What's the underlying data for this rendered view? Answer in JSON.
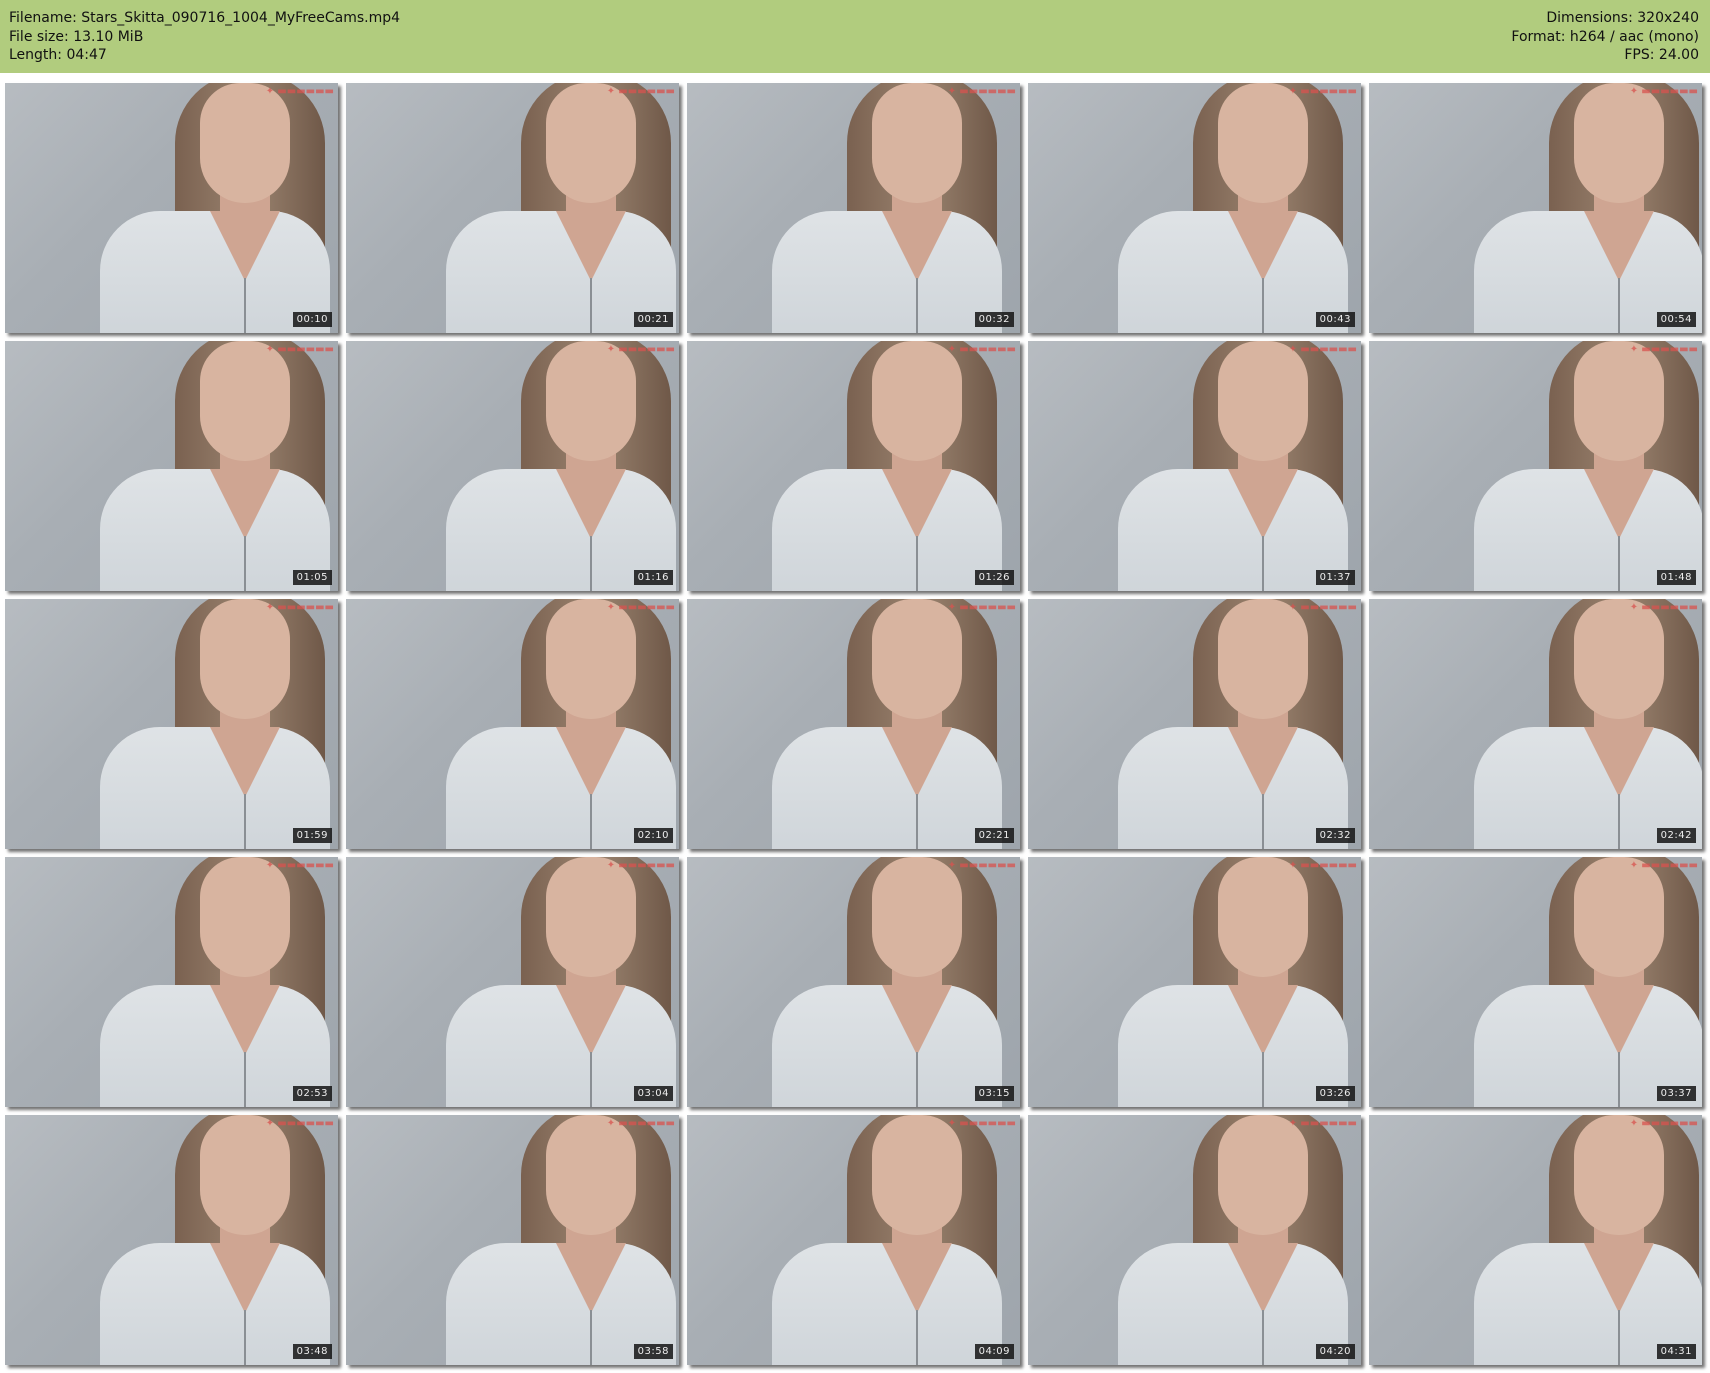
{
  "header": {
    "filename": "Filename: Stars_Skitta_090716_1004_MyFreeCams.mp4",
    "file_size": "File size: 13.10 MiB",
    "length": "Length: 04:47",
    "dimensions": "Dimensions: 320x240",
    "format": "Format: h264 / aac (mono)",
    "fps": "FPS: 24.00"
  },
  "colors": {
    "header_bg": "#b1cc7e"
  },
  "thumbnails": [
    "00:10",
    "00:21",
    "00:32",
    "00:43",
    "00:54",
    "01:05",
    "01:16",
    "01:26",
    "01:37",
    "01:48",
    "01:59",
    "02:10",
    "02:21",
    "02:32",
    "02:42",
    "02:53",
    "03:04",
    "03:15",
    "03:26",
    "03:37",
    "03:48",
    "03:58",
    "04:09",
    "04:20",
    "04:31"
  ]
}
